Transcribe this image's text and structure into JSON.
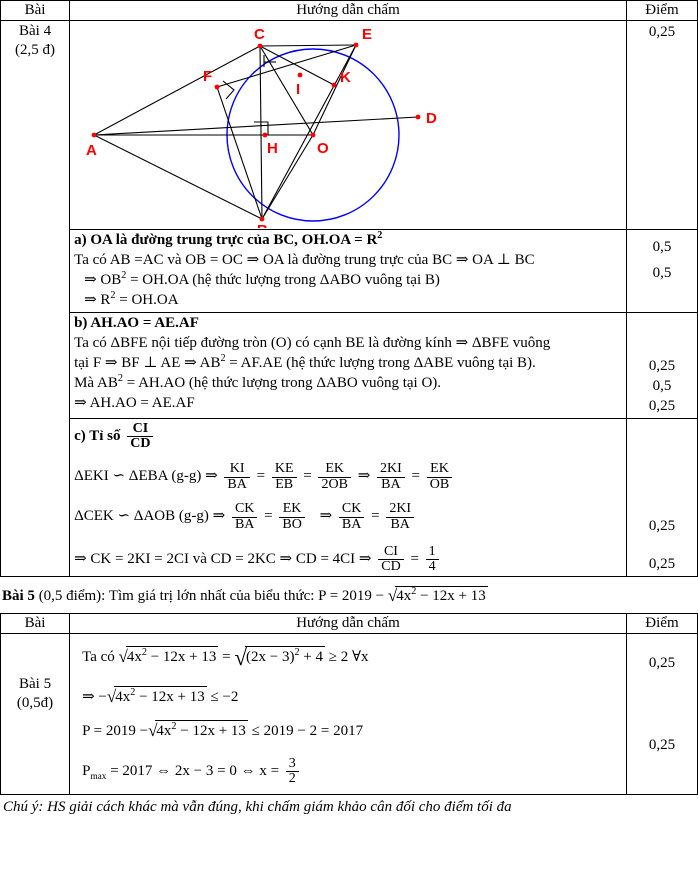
{
  "table_top": {
    "headers": {
      "bai": "Bài",
      "huong": "Hướng dẫn chấm",
      "diem": "Điểm"
    },
    "bai_label": {
      "line1": "Bài 4",
      "line2": "(2,5 đ)"
    },
    "rows": {
      "figure": {
        "points_text": "0,25"
      },
      "part_a": {
        "title": "a) OA là đường trung trực của BC, OH.OA = R",
        "title_sup": "2",
        "line1": "Ta có AB =AC và OB = OC ⇒ OA là đường trung trực của BC ⇒ OA ⊥ BC",
        "line2_pre": "⇒ OB",
        "line2_sup": "2",
        "line2_post": " = OH.OA (hệ thức lượng trong ΔABO vuông tại B)",
        "line3_pre": "⇒  R",
        "line3_sup": "2",
        "line3_post": " = OH.OA",
        "points": [
          "0,5",
          "0,5"
        ]
      },
      "part_b": {
        "title": "b) AH.AO = AE.AF",
        "line1": "Ta có ΔBFE nội tiếp đường tròn (O) có cạnh BE là đường kính ⇒  ΔBFE vuông",
        "line2_pre": "tại F ⇒  BF ⊥ AE  ⇒ AB",
        "line2_sup": "2",
        "line2_post": " = AF.AE (hệ thức lượng trong ΔABE vuông tại B).",
        "line3_pre": "Mà AB",
        "line3_sup": "2",
        "line3_post": " = AH.AO (hệ thức lượng trong ΔABO vuông tại O).",
        "line4": "⇒ AH.AO = AE.AF",
        "points": [
          "0,25",
          "0,5",
          "0,25"
        ]
      },
      "part_c": {
        "title_label": "c) Tỉ số",
        "title_frac": {
          "num": "CI",
          "den": "CD"
        },
        "sim1": {
          "left": "ΔEKI  ∽  ΔEBA (g-g) ⇒",
          "f1": {
            "num": "KI",
            "den": "BA"
          },
          "eq1": "=",
          "f2": {
            "num": "KE",
            "den": "EB"
          },
          "eq2": "=",
          "f3": {
            "num": "EK",
            "den": "2OB"
          },
          "arrow": "⇒",
          "f4": {
            "num": "2KI",
            "den": "BA"
          },
          "eq3": "=",
          "f5": {
            "num": "EK",
            "den": "OB"
          }
        },
        "sim2": {
          "left": "ΔCEK  ∽  ΔAOB (g-g) ⇒",
          "f1": {
            "num": "CK",
            "den": "BA"
          },
          "eq1": "=",
          "f2": {
            "num": "EK",
            "den": "BO"
          },
          "arrow": "⇒",
          "f3": {
            "num": "CK",
            "den": "BA"
          },
          "eq2": "=",
          "f4": {
            "num": "2KI",
            "den": "BA"
          }
        },
        "concl": {
          "t1": "⇒ CK = 2KI = 2CI và CD = 2KC  ⇒ CD = 4CI  ⇒",
          "f1": {
            "num": "CI",
            "den": "CD"
          },
          "eq": "=",
          "f2": {
            "num": "1",
            "den": "4"
          }
        },
        "points": [
          "0,25",
          "0,25"
        ]
      }
    }
  },
  "figure": {
    "caption_points": [
      "A",
      "B",
      "C",
      "D",
      "E",
      "F",
      "H",
      "I",
      "K",
      "O"
    ],
    "circle_color": "#0000ff",
    "point_color": "#ff0000",
    "line_color": "#000000",
    "labels": {
      "A": "A",
      "B": "B",
      "C": "C",
      "D": "D",
      "E": "E",
      "F": "F",
      "H": "H",
      "I": "I",
      "K": "K",
      "O": "O"
    }
  },
  "problem5": {
    "prefix": "Bài 5",
    "score": " (0,5 điểm): Tìm giá trị lớn nhất của biểu thức:  P = 2019 −",
    "radicand_pre": "4x",
    "radicand_sup": "2",
    "radicand_post": " − 12x + 13"
  },
  "table_bottom": {
    "headers": {
      "bai": "Bài",
      "huong": "Hướng dẫn chấm",
      "diem": "Điểm"
    },
    "bai_label": {
      "line1": "Bài 5",
      "line2": "(0,5đ)"
    },
    "line1": {
      "pre": "Ta có",
      "r1_pre": "4x",
      "r1_sup": "2",
      "r1_post": " − 12x + 13",
      "eq": "=",
      "r2_inner_pre": "(2x − 3)",
      "r2_inner_sup": "2",
      "r2_post": " + 4",
      "tail": "≥ 2 ∀x"
    },
    "line2": {
      "pre": "⇒ −",
      "r_pre": "4x",
      "r_sup": "2",
      "r_post": " − 12x + 13",
      "tail": "≤ −2"
    },
    "line3": {
      "pre": "P = 2019 −",
      "r_pre": "4x",
      "r_sup": "2",
      "r_post": " − 12x + 13",
      "tail": "≤ 2019 − 2 = 2017"
    },
    "line4": {
      "pre": "P",
      "sub": "max",
      "mid": " = 2017 ⇔ 2x − 3 = 0 ⇔ x =",
      "frac": {
        "num": "3",
        "den": "2"
      }
    },
    "points": [
      "0,25",
      "0,25"
    ]
  },
  "footer_note": "Chú ý: HS giải cách khác mà vẫn đúng, khi chấm giám khảo cân đối cho điểm tối đa"
}
